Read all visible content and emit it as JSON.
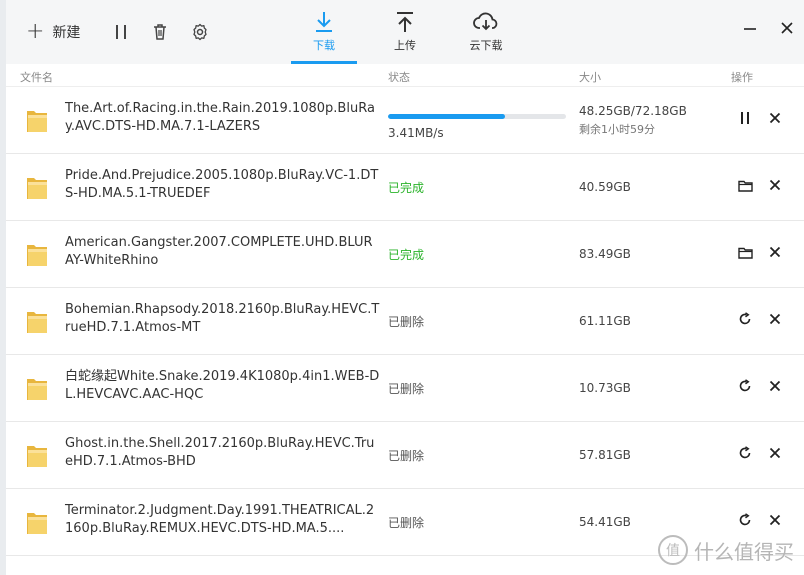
{
  "toolbar": {
    "new_label": "新建",
    "tabs": [
      {
        "label": "下载",
        "icon": "download-icon",
        "active": true
      },
      {
        "label": "上传",
        "icon": "upload-icon",
        "active": false
      },
      {
        "label": "云下载",
        "icon": "cloud-download-icon",
        "active": false
      }
    ]
  },
  "columns": {
    "name": "文件名",
    "status": "状态",
    "size": "大小",
    "actions": "操作"
  },
  "files": [
    {
      "name": "The.Art.of.Racing.in.the.Rain.2019.1080p.BluRay.AVC.DTS-HD.MA.7.1-LAZERS",
      "progress": 0.66,
      "speed": "3.41MB/s",
      "size": "48.25GB/72.18GB",
      "remaining": "剩余1小时59分",
      "actions": [
        "pause-icon",
        "close-icon"
      ]
    },
    {
      "name": "Pride.And.Prejudice.2005.1080p.BluRay.VC-1.DTS-HD.MA.5.1-TRUEDEF",
      "status": "已完成",
      "size": "40.59GB",
      "actions": [
        "open-folder-icon",
        "close-icon"
      ]
    },
    {
      "name": "American.Gangster.2007.COMPLETE.UHD.BLURAY-WhiteRhino",
      "status": "已完成",
      "size": "83.49GB",
      "actions": [
        "open-folder-icon",
        "close-icon"
      ]
    },
    {
      "name": "Bohemian.Rhapsody.2018.2160p.BluRay.HEVC.TrueHD.7.1.Atmos-MT",
      "status": "已删除",
      "size": "61.11GB",
      "actions": [
        "retry-icon",
        "close-icon"
      ]
    },
    {
      "name": "白蛇缘起White.Snake.2019.4K1080p.4in1.WEB-DL.HEVCAVC.AAC-HQC",
      "status": "已删除",
      "size": "10.73GB",
      "actions": [
        "retry-icon",
        "close-icon"
      ]
    },
    {
      "name": "Ghost.in.the.Shell.2017.2160p.BluRay.HEVC.TrueHD.7.1.Atmos-BHD",
      "status": "已删除",
      "size": "57.81GB",
      "actions": [
        "retry-icon",
        "close-icon"
      ]
    },
    {
      "name": "Terminator.2.Judgment.Day.1991.THEATRICAL.2160p.BluRay.REMUX.HEVC.DTS-HD.MA.5....",
      "status": "已删除",
      "size": "54.41GB",
      "actions": [
        "retry-icon",
        "close-icon"
      ]
    }
  ],
  "watermark": {
    "text": "什么值得买",
    "symbol": "值"
  },
  "colors": {
    "accent": "#1a9bf0",
    "done": "#2bb32b"
  }
}
